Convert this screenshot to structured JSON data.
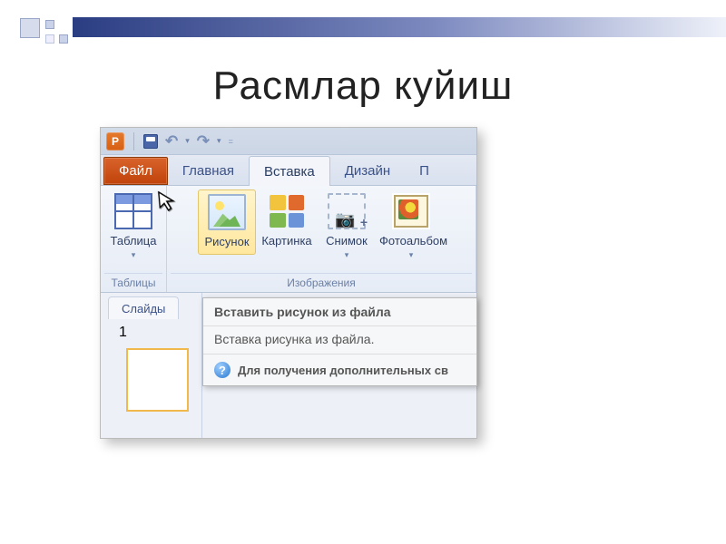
{
  "page": {
    "title": "Расмлар куйиш"
  },
  "qat": {
    "app_letter": "P"
  },
  "tabs": {
    "file": "Файл",
    "home": "Главная",
    "insert": "Вставка",
    "design": "Дизайн",
    "next_partial": "П"
  },
  "ribbon": {
    "groups": {
      "tables": {
        "label": "Таблицы",
        "cmd_table": "Таблица"
      },
      "images": {
        "label": "Изображения",
        "cmd_picture": "Рисунок",
        "cmd_clipart": "Картинка",
        "cmd_snapshot": "Снимок",
        "cmd_album": "Фотоальбом"
      }
    }
  },
  "slidepane": {
    "tab": "Слайды",
    "current_slide_number": "1"
  },
  "tooltip": {
    "title": "Вставить рисунок из файла",
    "body": "Вставка рисунка из файла.",
    "help": "Для получения дополнительных св"
  }
}
